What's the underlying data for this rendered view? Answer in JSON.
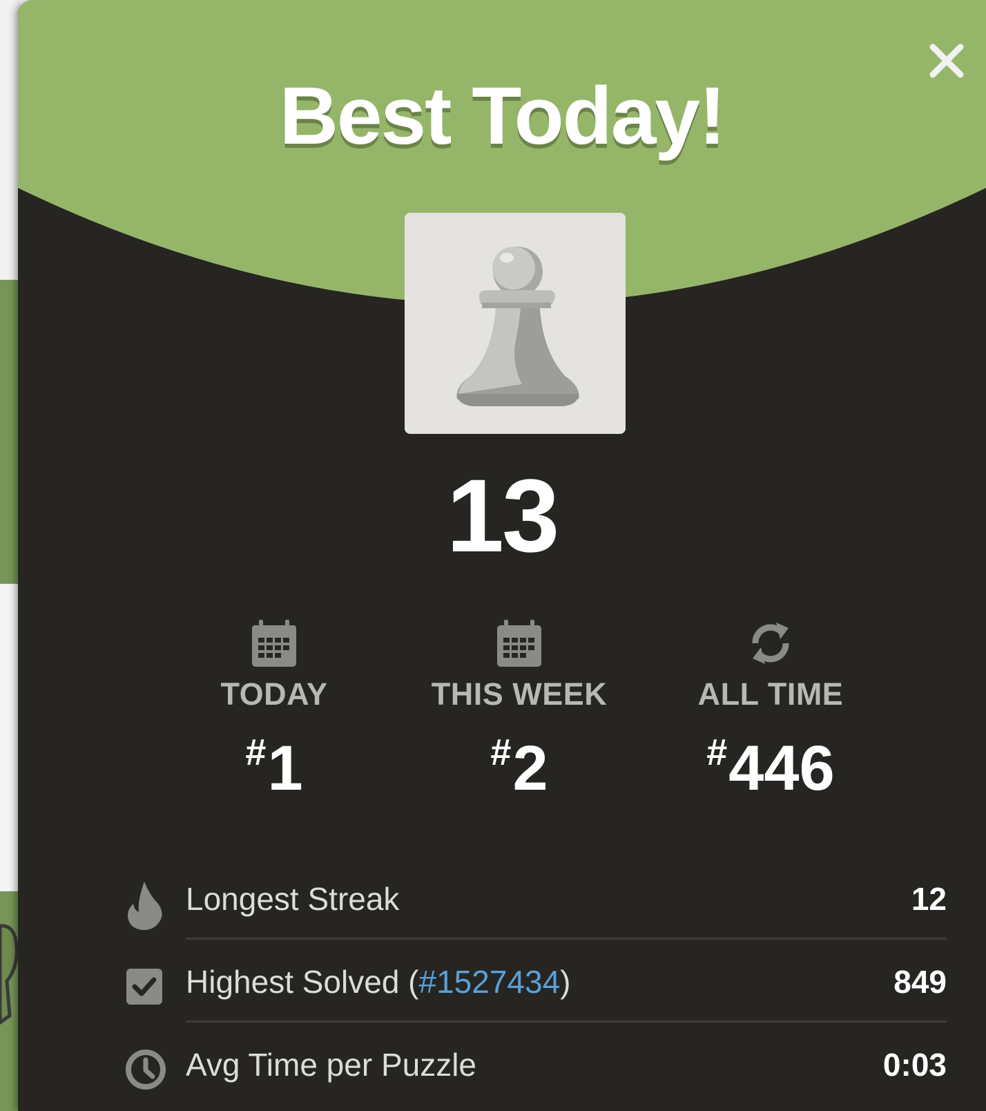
{
  "modal": {
    "title": "Best Today!",
    "score": "13",
    "colors": {
      "header_green": "#95b669",
      "body_dark": "#262522",
      "link_blue": "#5aa0d8"
    }
  },
  "rankings": [
    {
      "icon": "calendar-icon",
      "label": "TODAY",
      "hash": "#",
      "value": "1"
    },
    {
      "icon": "calendar-icon",
      "label": "THIS WEEK",
      "hash": "#",
      "value": "2"
    },
    {
      "icon": "refresh-icon",
      "label": "ALL TIME",
      "hash": "#",
      "value": "446"
    }
  ],
  "stats": {
    "streak": {
      "icon": "flame-icon",
      "label": "Longest Streak",
      "value": "12"
    },
    "highest": {
      "icon": "checkbox-icon",
      "label_before": "Highest Solved (",
      "link": "#1527434",
      "label_after": ")",
      "value": "849"
    },
    "avg_time": {
      "icon": "clock-icon",
      "label": "Avg Time per Puzzle",
      "value": "0:03"
    }
  }
}
